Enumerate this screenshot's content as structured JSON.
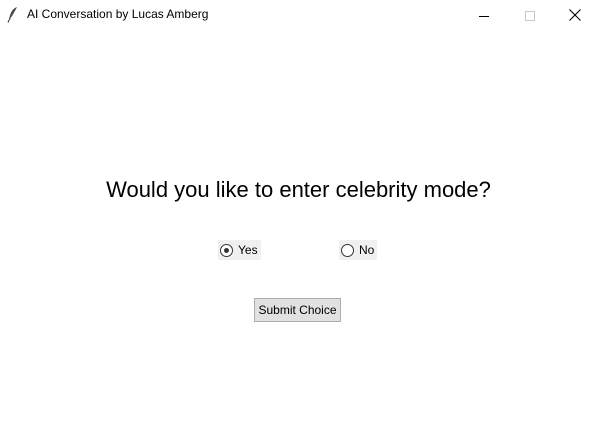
{
  "window": {
    "title": "AI Conversation by Lucas Amberg",
    "icon": "feather-icon",
    "controls": [
      "minimize-icon",
      "maximize-icon",
      "close-icon"
    ]
  },
  "main": {
    "question": "Would you like to enter celebrity mode?",
    "options": [
      {
        "label": "Yes",
        "selected": true
      },
      {
        "label": "No",
        "selected": false
      }
    ],
    "submit_label": "Submit Choice"
  }
}
